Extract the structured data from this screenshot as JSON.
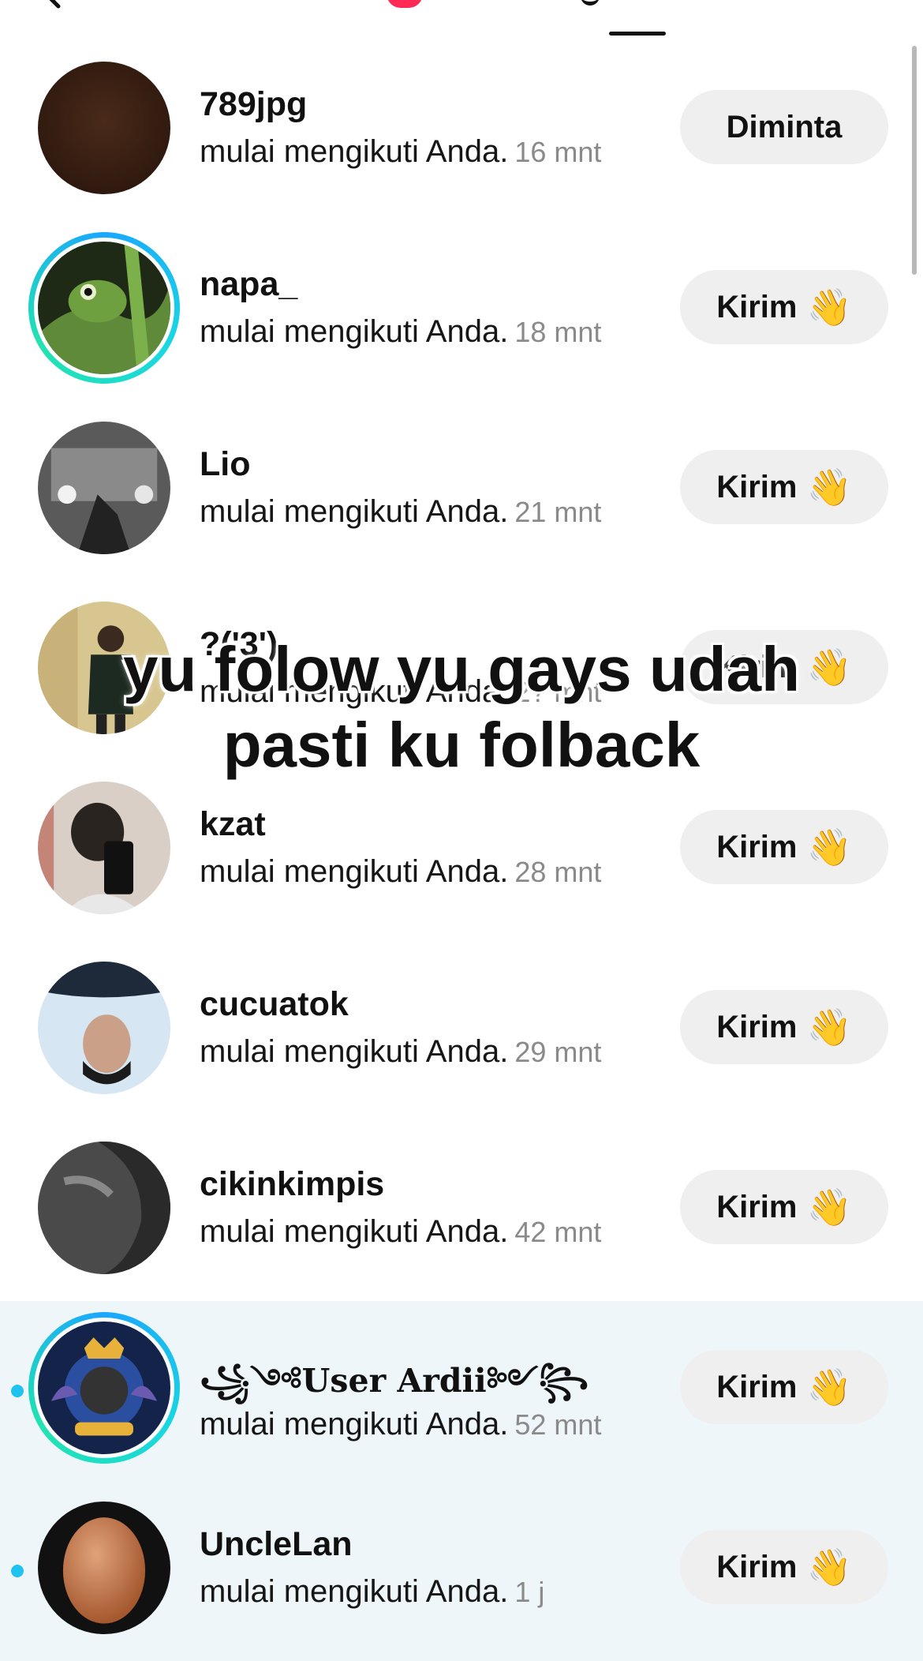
{
  "colors": {
    "accent": "#ff2a55",
    "unread": "#20c3f0",
    "button_bg": "#efefef",
    "unread_row": "#eef6fa"
  },
  "items": [
    {
      "name": "789jpg",
      "action": "mulai mengikuti Anda.",
      "time": "16 mnt",
      "button": "Diminta",
      "wave": "",
      "story_ring": false,
      "unread": false,
      "avatar_icon": "brown-avatar"
    },
    {
      "name": "napa_",
      "action": "mulai mengikuti Anda.",
      "time": "18 mnt",
      "button": "Kirim",
      "wave": "👋",
      "story_ring": true,
      "unread": false,
      "avatar_icon": "frog-avatar"
    },
    {
      "name": "Lio",
      "action": "mulai mengikuti Anda.",
      "time": "21 mnt",
      "button": "Kirim",
      "wave": "👋",
      "story_ring": false,
      "unread": false,
      "avatar_icon": "room-avatar"
    },
    {
      "name": "?('3')",
      "action": "mulai mengikuti Anda.",
      "time": "2? mnt",
      "button": "Kirim",
      "wave": "👋",
      "story_ring": false,
      "unread": false,
      "avatar_icon": "person-avatar"
    },
    {
      "name": "kzat",
      "action": "mulai mengikuti Anda.",
      "time": "28 mnt",
      "button": "Kirim",
      "wave": "👋",
      "story_ring": false,
      "unread": false,
      "avatar_icon": "selfie-avatar"
    },
    {
      "name": "cucuatok",
      "action": "mulai mengikuti Anda.",
      "time": "29 mnt",
      "button": "Kirim",
      "wave": "👋",
      "story_ring": false,
      "unread": false,
      "avatar_icon": "upside-down-avatar"
    },
    {
      "name": "cikinkimpis",
      "action": "mulai mengikuti Anda.",
      "time": "42 mnt",
      "button": "Kirim",
      "wave": "👋",
      "story_ring": false,
      "unread": false,
      "avatar_icon": "grayscale-avatar"
    },
    {
      "name": "꧁༺User Ardii༻꧂",
      "action": "mulai mengikuti Anda.",
      "time": "52 mnt",
      "button": "Kirim",
      "wave": "👋",
      "story_ring": true,
      "unread": true,
      "avatar_icon": "emblem-avatar"
    },
    {
      "name": "UncleLan",
      "action": "mulai mengikuti Anda.",
      "time": "1 j",
      "button": "Kirim",
      "wave": "👋",
      "story_ring": false,
      "unread": true,
      "avatar_icon": "egg-avatar"
    }
  ],
  "overlay_text": [
    "yu folow yu gays udah",
    "pasti ku folback"
  ]
}
